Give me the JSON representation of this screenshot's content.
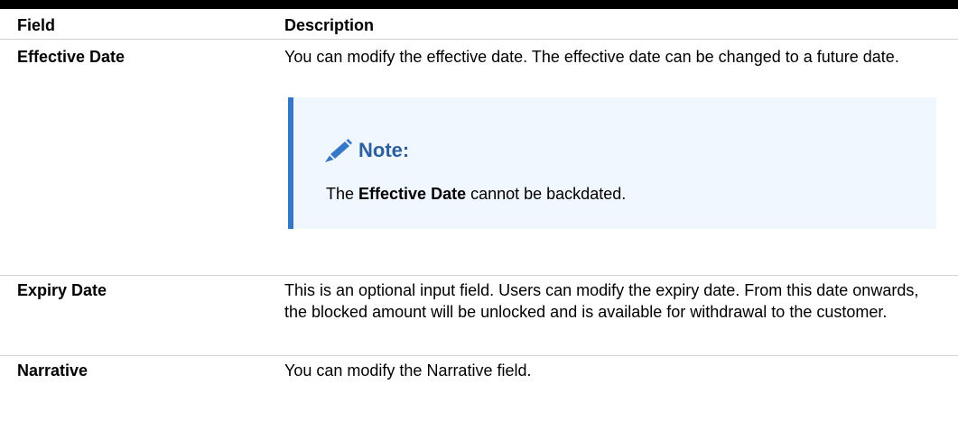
{
  "table": {
    "headers": {
      "field": "Field",
      "description": "Description"
    },
    "rows": [
      {
        "field": "Effective Date",
        "description": "You can modify the effective date. The effective date can be changed to a future date.",
        "note": {
          "icon": "pencil-icon",
          "title": "Note:",
          "text_before": "The ",
          "text_bold": "Effective Date",
          "text_after": " cannot be backdated."
        }
      },
      {
        "field": "Expiry Date",
        "description": "This is an optional input field. Users can modify the expiry date. From this date onwards, the blocked amount will be unlocked and is available for withdrawal to the customer."
      },
      {
        "field": "Narrative",
        "description": "You can modify the Narrative field."
      }
    ]
  },
  "colors": {
    "top_rule": "#000000",
    "note_background": "#f0f7ff",
    "note_border": "#3578c7",
    "note_title": "#2d5f9e"
  }
}
